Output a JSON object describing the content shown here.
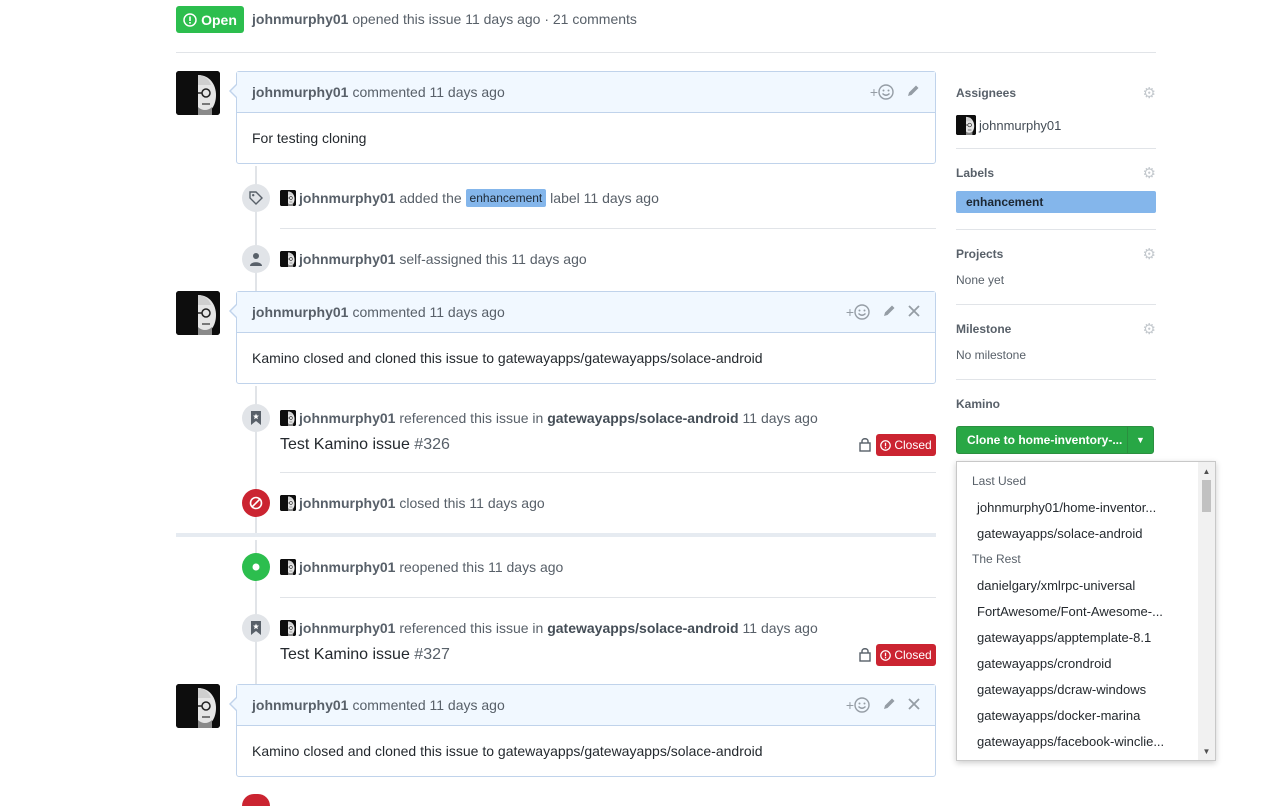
{
  "issue_header": {
    "state": "Open",
    "author": "johnmurphy01",
    "meta": "opened this issue 11 days ago · 21 comments"
  },
  "timeline": {
    "comment1": {
      "author": "johnmurphy01",
      "meta": "commented 11 days ago",
      "body": "For testing cloning"
    },
    "event_label": {
      "actor": "johnmurphy01",
      "pre": "added the",
      "label": "enhancement",
      "post": "label 11 days ago"
    },
    "event_assign": {
      "actor": "johnmurphy01",
      "text": "self-assigned this 11 days ago"
    },
    "comment2": {
      "author": "johnmurphy01",
      "meta": "commented 11 days ago",
      "body": "Kamino closed and cloned this issue to gatewayapps/gatewayapps/solace-android"
    },
    "ref1": {
      "actor": "johnmurphy01",
      "pre": "referenced this issue in",
      "repo": "gatewayapps/solace-android",
      "time": "11 days ago",
      "title": "Test Kamino issue",
      "number": "#326",
      "status": "Closed"
    },
    "event_closed": {
      "actor": "johnmurphy01",
      "text": "closed this 11 days ago"
    },
    "event_reopened": {
      "actor": "johnmurphy01",
      "text": "reopened this 11 days ago"
    },
    "ref2": {
      "actor": "johnmurphy01",
      "pre": "referenced this issue in",
      "repo": "gatewayapps/solace-android",
      "time": "11 days ago",
      "title": "Test Kamino issue",
      "number": "#327",
      "status": "Closed"
    },
    "comment3": {
      "author": "johnmurphy01",
      "meta": "commented 11 days ago",
      "body": "Kamino closed and cloned this issue to gatewayapps/gatewayapps/solace-android"
    }
  },
  "sidebar": {
    "assignees": {
      "heading": "Assignees",
      "value": "johnmurphy01"
    },
    "labels": {
      "heading": "Labels",
      "value": "enhancement",
      "color": "#84b6eb"
    },
    "projects": {
      "heading": "Projects",
      "value": "None yet"
    },
    "milestone": {
      "heading": "Milestone",
      "value": "No milestone"
    },
    "kamino": {
      "heading": "Kamino",
      "button_label": "Clone to home-inventory-..."
    }
  },
  "dropdown": {
    "group_recent": "Last Used",
    "recent": [
      "johnmurphy01/home-inventor...",
      "gatewayapps/solace-android"
    ],
    "group_rest": "The Rest",
    "rest": [
      "danielgary/xmlrpc-universal",
      "FortAwesome/Font-Awesome-...",
      "gatewayapps/apptemplate-8.1",
      "gatewayapps/crondroid",
      "gatewayapps/dcraw-windows",
      "gatewayapps/docker-marina",
      "gatewayapps/facebook-winclie..."
    ]
  },
  "colors": {
    "open_green": "#2cbe4e",
    "closed_red": "#cb2431",
    "label_blue": "#84b6eb",
    "button_green": "#28a745"
  }
}
